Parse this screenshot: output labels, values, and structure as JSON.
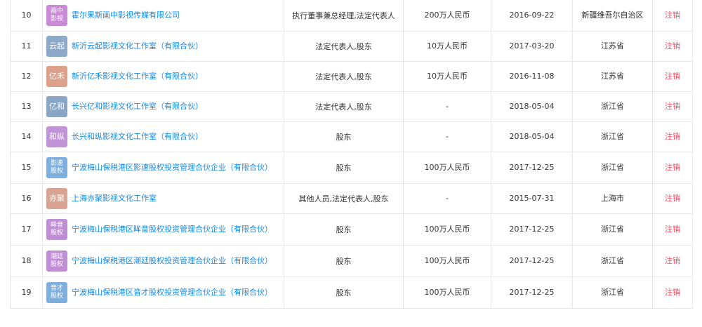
{
  "rows": [
    {
      "index": "10",
      "logo_l1": "画中",
      "logo_l2": "影视",
      "logo_color": "#c98bd6",
      "name": "霍尔果斯画中影视传媒有限公司",
      "role": "执行董事兼总经理,法定代表人",
      "capital": "200万人民币",
      "date": "2016-09-22",
      "region": "新疆维吾尔自治区",
      "status": "注销"
    },
    {
      "index": "11",
      "logo_l1": "云起",
      "logo_l2": "",
      "logo_color": "#8da9ca",
      "name": "新沂云起影视文化工作室（有限合伙）",
      "role": "法定代表人,股东",
      "capital": "10万人民币",
      "date": "2017-03-20",
      "region": "江苏省",
      "status": "注销"
    },
    {
      "index": "12",
      "logo_l1": "亿禾",
      "logo_l2": "",
      "logo_color": "#dca08b",
      "name": "新沂亿禾影视文化工作室（有限合伙）",
      "role": "法定代表人,股东",
      "capital": "10万人民币",
      "date": "2016-11-08",
      "region": "江苏省",
      "status": "注销"
    },
    {
      "index": "13",
      "logo_l1": "亿和",
      "logo_l2": "",
      "logo_color": "#8aa6c7",
      "name": "长兴亿和影视文化工作室（有限合伙）",
      "role": "法定代表人,股东",
      "capital": "-",
      "date": "2018-05-04",
      "region": "浙江省",
      "status": "注销"
    },
    {
      "index": "14",
      "logo_l1": "和纵",
      "logo_l2": "",
      "logo_color": "#c194d8",
      "name": "长兴和纵影视文化工作室（有限合伙）",
      "role": "股东",
      "capital": "-",
      "date": "2018-05-04",
      "region": "浙江省",
      "status": "注销"
    },
    {
      "index": "15",
      "logo_l1": "影速",
      "logo_l2": "股权",
      "logo_color": "#7fb0dd",
      "name": "宁波梅山保税港区影速股权投资管理合伙企业（有限合伙）",
      "role": "股东",
      "capital": "100万人民币",
      "date": "2017-12-25",
      "region": "浙江省",
      "status": "注销"
    },
    {
      "index": "16",
      "logo_l1": "亦聚",
      "logo_l2": "",
      "logo_color": "#d9a393",
      "name": "上海亦聚影视文化工作室",
      "role": "其他人员,法定代表人,股东",
      "capital": "-",
      "date": "2015-07-31",
      "region": "上海市",
      "status": "注销"
    },
    {
      "index": "17",
      "logo_l1": "眸音",
      "logo_l2": "股权",
      "logo_color": "#c08ed5",
      "name": "宁波梅山保税港区眸音股权投资管理合伙企业（有限合伙）",
      "role": "股东",
      "capital": "100万人民币",
      "date": "2017-12-25",
      "region": "浙江省",
      "status": "注销"
    },
    {
      "index": "18",
      "logo_l1": "潮廷",
      "logo_l2": "股权",
      "logo_color": "#c08ed5",
      "name": "宁波梅山保税港区潮廷股权投资管理合伙企业（有限合伙）",
      "role": "股东",
      "capital": "100万人民币",
      "date": "2017-12-25",
      "region": "浙江省",
      "status": "注销"
    },
    {
      "index": "19",
      "logo_l1": "音才",
      "logo_l2": "股权",
      "logo_color": "#7fb0dd",
      "name": "宁波梅山保税港区音才股权投资管理合伙企业（有限合伙）",
      "role": "股东",
      "capital": "100万人民币",
      "date": "2017-12-25",
      "region": "浙江省",
      "status": "注销"
    }
  ]
}
